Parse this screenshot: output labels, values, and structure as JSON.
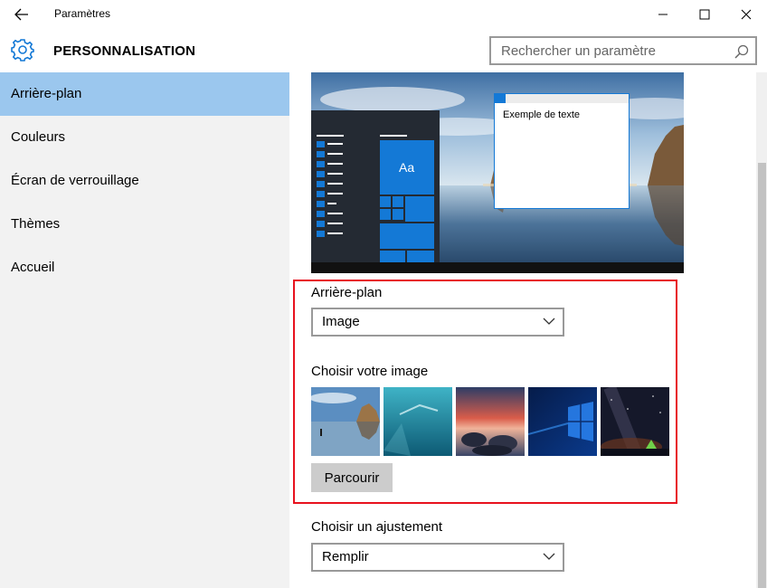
{
  "window": {
    "title": "Paramètres"
  },
  "header": {
    "section_title": "PERSONNALISATION",
    "search_placeholder": "Rechercher un paramètre"
  },
  "sidebar": {
    "items": [
      {
        "label": "Arrière-plan",
        "active": true
      },
      {
        "label": "Couleurs",
        "active": false
      },
      {
        "label": "Écran de verrouillage",
        "active": false
      },
      {
        "label": "Thèmes",
        "active": false
      },
      {
        "label": "Accueil",
        "active": false
      }
    ]
  },
  "preview": {
    "tile_text": "Aa",
    "sample_text": "Exemple de texte"
  },
  "background": {
    "label": "Arrière-plan",
    "selected": "Image"
  },
  "choose_image": {
    "label": "Choisir votre image",
    "thumbnails": [
      "beach-rocks",
      "underwater-swimmer",
      "rocky-shore-sunset",
      "windows-logo",
      "night-sky-tent"
    ],
    "browse_label": "Parcourir"
  },
  "fit": {
    "label": "Choisir un ajustement",
    "selected": "Remplir"
  },
  "colors": {
    "accent": "#1479d6",
    "active_nav": "#9bc7ee",
    "highlight": "#e8121e"
  }
}
